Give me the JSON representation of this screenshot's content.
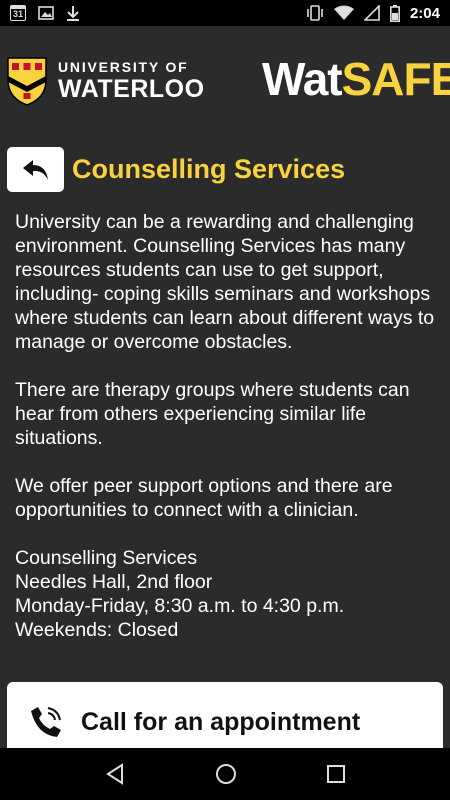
{
  "status_bar": {
    "calendar_day": "31",
    "time": "2:04",
    "icons": [
      "calendar-icon",
      "image-icon",
      "download-icon",
      "vibrate-icon",
      "wifi-icon",
      "signal-icon",
      "battery-icon"
    ]
  },
  "header": {
    "uw_line1": "UNIVERSITY OF",
    "uw_line2": "WATERLOO",
    "brand_wat": "Wat",
    "brand_safe": "SAFE"
  },
  "page": {
    "title": "Counselling Services",
    "paragraphs": [
      "University can be a rewarding and challenging environment. Counselling Services has many resources students can use to get support, including- coping skills seminars and workshops where students can learn about different ways to manage or overcome obstacles.",
      "There are therapy groups where students can hear from others experiencing similar life situations.",
      "We offer peer support options and there are opportunities to connect with a clinician."
    ],
    "address": {
      "name": "Counselling Services",
      "location": "Needles Hall, 2nd floor",
      "hours": "Monday-Friday, 8:30 a.m. to 4:30 p.m.",
      "weekends": "Weekends: Closed"
    },
    "call_button": "Call for an appointment"
  },
  "colors": {
    "accent": "#f9d33f",
    "background": "#2b2b2b"
  }
}
